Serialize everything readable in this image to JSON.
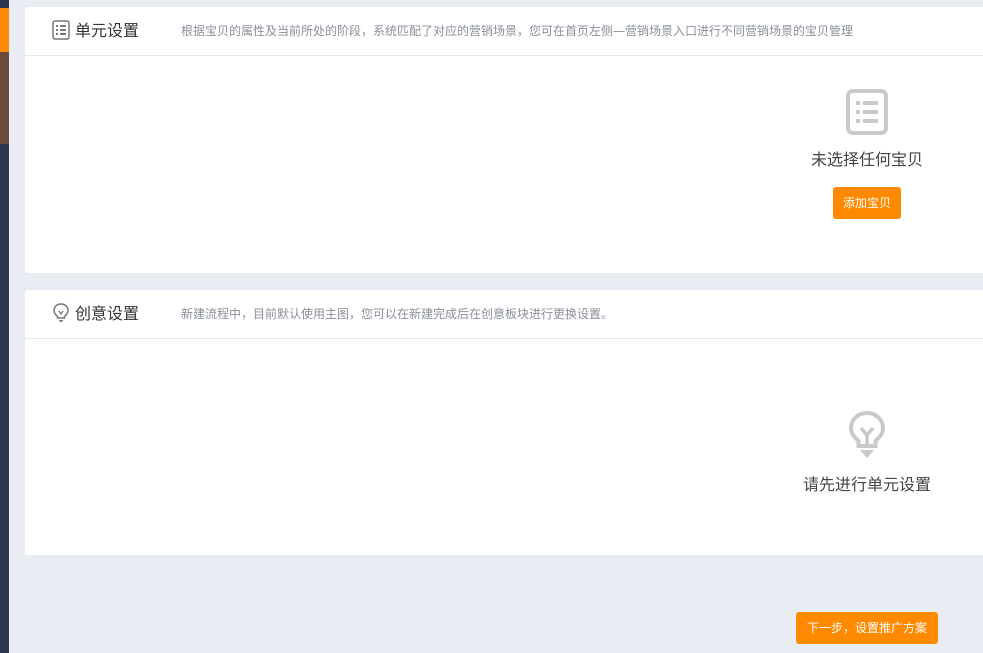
{
  "unit_settings": {
    "title": "单元设置",
    "description": "根据宝贝的属性及当前所处的阶段，系统匹配了对应的营销场景，您可在首页左侧—营销场景入口进行不同营销场景的宝贝管理",
    "icon": "list-icon",
    "empty_text": "未选择任何宝贝",
    "add_button_label": "添加宝贝"
  },
  "creative_settings": {
    "title": "创意设置",
    "description": "新建流程中，目前默认使用主图，您可以在新建完成后在创意板块进行更换设置。",
    "icon": "lightbulb-icon",
    "empty_text": "请先进行单元设置"
  },
  "footer": {
    "next_button_label": "下一步，设置推广方案"
  },
  "colors": {
    "accent": "#ff8a00",
    "rail": "#2e3650",
    "background": "#e9ecf3",
    "icon_gray": "#c9c9c9"
  }
}
